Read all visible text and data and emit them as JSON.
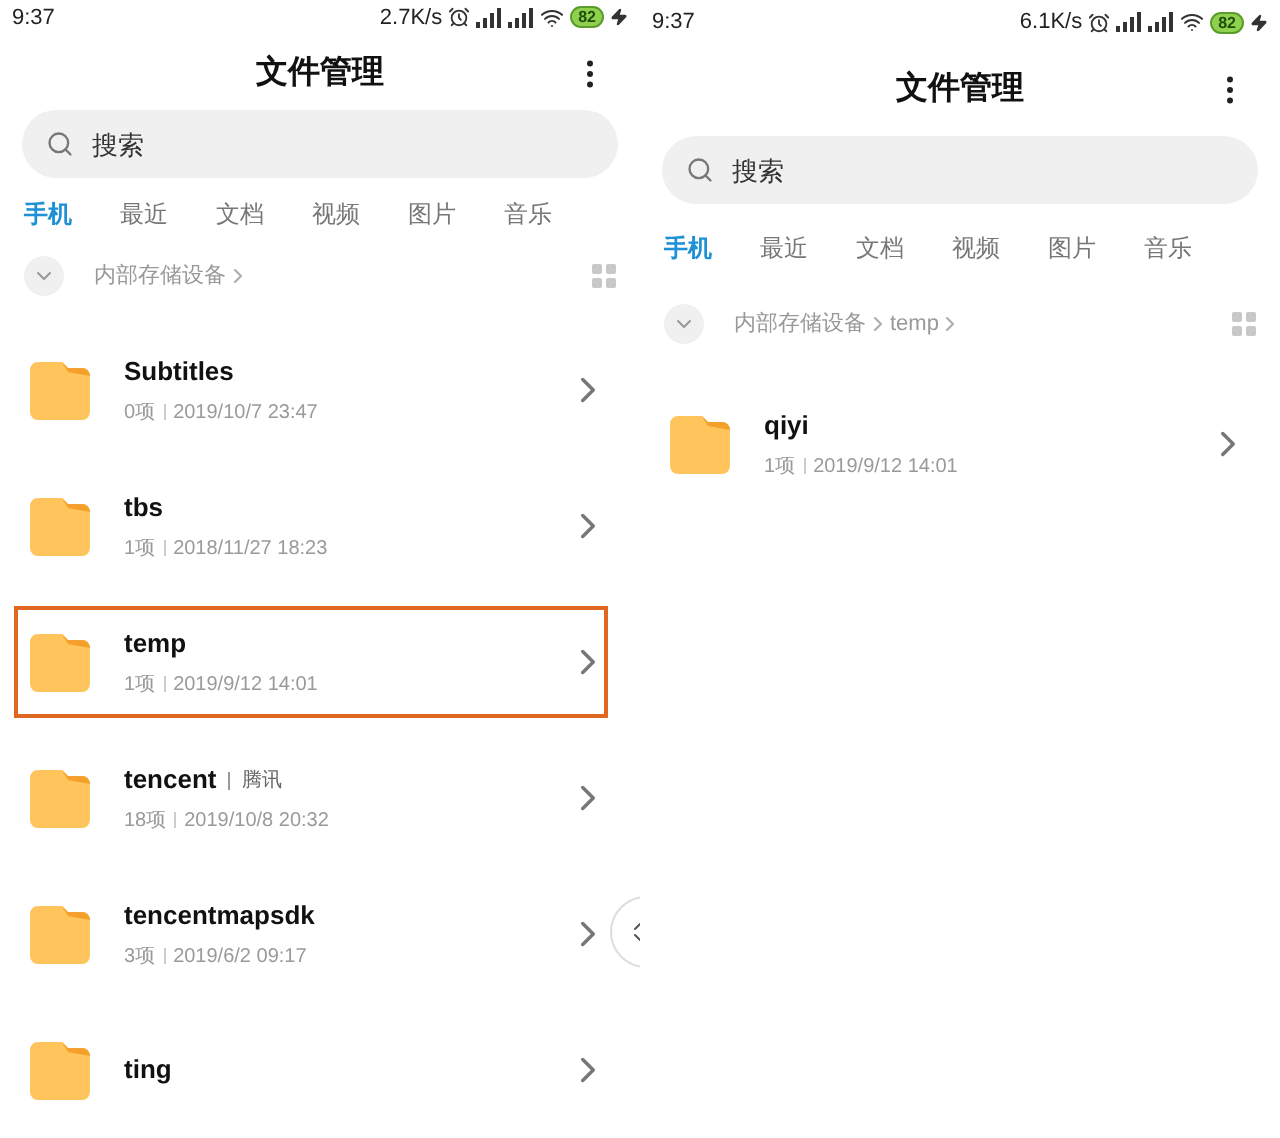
{
  "screens": [
    {
      "status_bar": {
        "time": "9:37",
        "speed": "2.7K/s",
        "battery": "82"
      },
      "title": "文件管理",
      "search": {
        "placeholder": "搜索"
      },
      "tabs": [
        {
          "label": "手机",
          "selected": true
        },
        {
          "label": "最近",
          "selected": false
        },
        {
          "label": "文档",
          "selected": false
        },
        {
          "label": "视频",
          "selected": false
        },
        {
          "label": "图片",
          "selected": false
        },
        {
          "label": "音乐",
          "selected": false
        }
      ],
      "breadcrumb": [
        "内部存储设备"
      ],
      "fast_scroll": true,
      "items": [
        {
          "name": "Subtitles",
          "count": "0项",
          "date": "2019/10/7 23:47",
          "selected": false
        },
        {
          "name": "tbs",
          "count": "1项",
          "date": "2018/11/27 18:23",
          "selected": false
        },
        {
          "name": "temp",
          "count": "1项",
          "date": "2019/9/12 14:01",
          "selected": true
        },
        {
          "name": "tencent",
          "tag": "腾讯",
          "count": "18项",
          "date": "2019/10/8 20:32",
          "selected": false
        },
        {
          "name": "tencentmapsdk",
          "count": "3项",
          "date": "2019/6/2 09:17",
          "selected": false
        },
        {
          "name": "ting",
          "selected": false
        }
      ]
    },
    {
      "status_bar": {
        "time": "9:37",
        "speed": "6.1K/s",
        "battery": "82"
      },
      "title": "文件管理",
      "search": {
        "placeholder": "搜索"
      },
      "tabs": [
        {
          "label": "手机",
          "selected": true
        },
        {
          "label": "最近",
          "selected": false
        },
        {
          "label": "文档",
          "selected": false
        },
        {
          "label": "视频",
          "selected": false
        },
        {
          "label": "图片",
          "selected": false
        },
        {
          "label": "音乐",
          "selected": false
        }
      ],
      "breadcrumb": [
        "内部存储设备",
        "temp"
      ],
      "fast_scroll": false,
      "items": [
        {
          "name": "qiyi",
          "count": "1项",
          "date": "2019/9/12 14:01",
          "selected": false
        }
      ]
    }
  ]
}
